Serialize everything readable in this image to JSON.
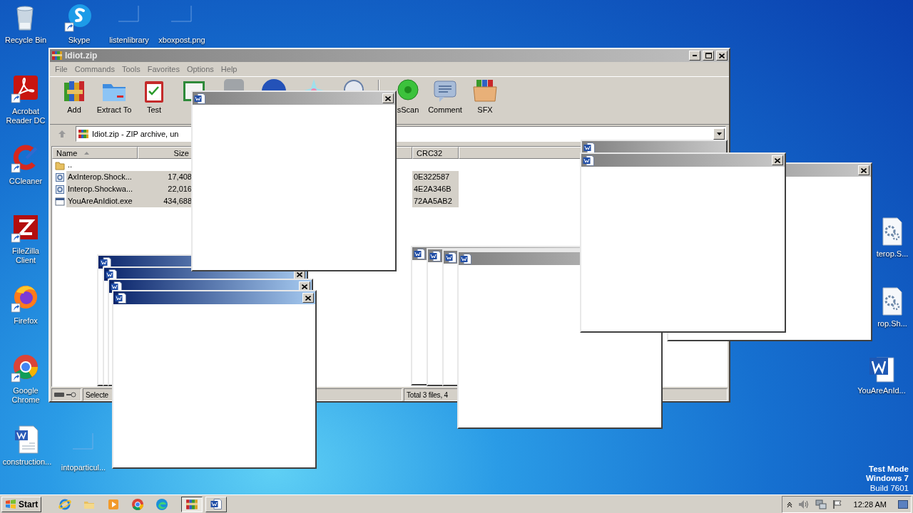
{
  "desktop": {
    "icons": [
      {
        "label": "Recycle Bin",
        "kind": "trash",
        "shortcut": false
      },
      {
        "label": "Skype",
        "kind": "skype",
        "shortcut": true
      },
      {
        "label": "listenlibrary",
        "kind": "blank",
        "shortcut": false
      },
      {
        "label": "xboxpost.png",
        "kind": "blank",
        "shortcut": false
      },
      {
        "label": "Acrobat Reader DC",
        "kind": "pdf",
        "shortcut": true
      },
      {
        "label": "CCleaner",
        "kind": "cleaner",
        "shortcut": true
      },
      {
        "label": "FileZilla Client",
        "kind": "ftp",
        "shortcut": true
      },
      {
        "label": "Firefox",
        "kind": "firefox",
        "shortcut": true
      },
      {
        "label": "Google Chrome",
        "kind": "chrome",
        "shortcut": true
      },
      {
        "label": "construction...",
        "kind": "word",
        "shortcut": false
      },
      {
        "label": "intoparticul...",
        "kind": "blank",
        "shortcut": false
      },
      {
        "label": "terop.S...",
        "kind": "gear",
        "shortcut": false
      },
      {
        "label": "rop.Sh...",
        "kind": "gear",
        "shortcut": false
      },
      {
        "label": "YouAreAnId...",
        "kind": "wordlarge",
        "shortcut": false
      }
    ],
    "os_notice": [
      "Test Mode",
      "Windows 7",
      "Build 7601"
    ]
  },
  "archive_window": {
    "title": "Idiot.zip",
    "menu": [
      "File",
      "Commands",
      "Tools",
      "Favorites",
      "Options",
      "Help"
    ],
    "toolbar": [
      {
        "kind": "add",
        "label": "Add"
      },
      {
        "kind": "extract",
        "label": "Extract To"
      },
      {
        "kind": "test",
        "label": "Test"
      },
      {
        "kind": "view"
      },
      {
        "kind": "delete"
      },
      {
        "kind": "find"
      },
      {
        "kind": "wizard"
      },
      {
        "kind": "info"
      },
      {
        "kind": "scan",
        "label": "sScan"
      },
      {
        "kind": "comment",
        "label": "Comment"
      },
      {
        "kind": "sfx",
        "label": "SFX"
      }
    ],
    "path": "Idiot.zip - ZIP archive, un",
    "columns": [
      {
        "label": "Name",
        "sorted": true
      },
      {
        "label": "Size",
        "sorted": false
      },
      {
        "label": "CRC32",
        "sorted": false
      }
    ],
    "rows": [
      {
        "kind": "folder",
        "name": "..",
        "selected": false
      },
      {
        "kind": "library",
        "name": "AxInterop.Shock...",
        "size": "17,408",
        "crc32": "0E322587",
        "selected": true
      },
      {
        "kind": "library",
        "name": "Interop.Shockwa...",
        "size": "22,016",
        "crc32": "4E2A346B",
        "selected": true
      },
      {
        "kind": "program",
        "name": "YouAreAnIdiot.exe",
        "size": "434,688",
        "crc32": "72AA5AB2",
        "selected": true
      }
    ],
    "status": {
      "selection": "Selecte",
      "total": "Total 3 files, 4"
    }
  },
  "popups": [
    {
      "active": true
    },
    {
      "active": true
    },
    {
      "active": true
    },
    {
      "active": true
    },
    {
      "active": false
    },
    {
      "active": false
    },
    {
      "active": false
    },
    {
      "active": false
    },
    {
      "active": false
    },
    {
      "active": false
    },
    {
      "active": false
    },
    {
      "active": false
    }
  ],
  "taskbar": {
    "start": "Start",
    "quick_launch": [
      {
        "kind": "ie"
      },
      {
        "kind": "explorer"
      },
      {
        "kind": "media"
      },
      {
        "kind": "chrome"
      },
      {
        "kind": "edge"
      }
    ],
    "tasks": [
      {
        "kind": "archiver",
        "selected": true
      },
      {
        "kind": "word",
        "selected": false
      }
    ],
    "time": "12:28 AM"
  }
}
